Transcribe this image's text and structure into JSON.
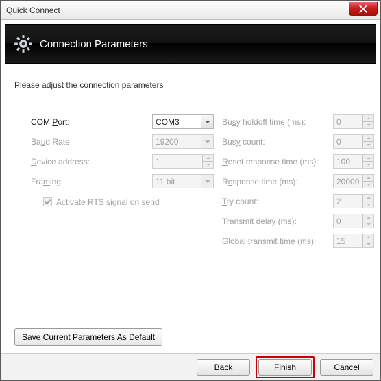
{
  "window": {
    "title": "Quick Connect"
  },
  "banner": {
    "title": "Connection Parameters"
  },
  "instruction": "Please adjust the connection parameters",
  "left": {
    "com_port": {
      "label_pre": "COM ",
      "label_u": "P",
      "label_post": "ort:",
      "value": "COM3"
    },
    "baud_rate": {
      "label_pre": "Ba",
      "label_u": "u",
      "label_post": "d Rate:",
      "value": "19200"
    },
    "device_addr": {
      "label_pre": "",
      "label_u": "D",
      "label_post": "evice address:",
      "value": "1"
    },
    "framing": {
      "label_pre": "Fra",
      "label_u": "m",
      "label_post": "ing:",
      "value": "11 bit"
    },
    "activate_rts": {
      "label_pre": "",
      "label_u": "A",
      "label_post": "ctivate RTS signal on send"
    }
  },
  "right": {
    "busy_holdoff": {
      "label_pre": "Bu",
      "label_u": "s",
      "label_post": "y holdoff time (ms):",
      "value": "0"
    },
    "busy_count": {
      "label_pre": "Bus",
      "label_u": "y",
      "label_post": " count:",
      "value": "0"
    },
    "reset_resp": {
      "label_pre": "",
      "label_u": "R",
      "label_post": "eset response time (ms):",
      "value": "100"
    },
    "resp_time": {
      "label_pre": "R",
      "label_u": "e",
      "label_post": "sponse time (ms):",
      "value": "20000"
    },
    "try_count": {
      "label_pre": "",
      "label_u": "T",
      "label_post": "ry count:",
      "value": "2"
    },
    "transmit_delay": {
      "label_pre": "Tra",
      "label_u": "n",
      "label_post": "smit delay (ms):",
      "value": "0"
    },
    "global_transmit": {
      "label_pre": "",
      "label_u": "G",
      "label_post": "lobal transmit time (ms):",
      "value": "15"
    }
  },
  "buttons": {
    "save_default": "Save Current Parameters As Default",
    "back_u": "B",
    "back_post": "ack",
    "finish_u": "F",
    "finish_post": "inish",
    "cancel": "Cancel"
  }
}
